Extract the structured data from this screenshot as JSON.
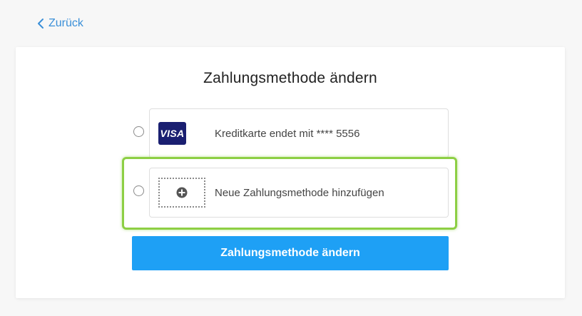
{
  "nav": {
    "back_label": "Zurück"
  },
  "page": {
    "title": "Zahlungsmethode ändern"
  },
  "options": [
    {
      "icon": "visa-card-icon",
      "logo_text": "VISA",
      "label": "Kreditkarte endet mit **** 5556",
      "selected": false
    },
    {
      "icon": "plus-circle-icon",
      "label": "Neue Zahlungsmethode hinzufügen",
      "selected": false
    }
  ],
  "actions": {
    "submit_label": "Zahlungsmethode ändern"
  },
  "colors": {
    "accent": "#1ea0f5",
    "link": "#3a8fd8",
    "visa_brand": "#1a1f71",
    "highlight": "#8dcf44"
  }
}
